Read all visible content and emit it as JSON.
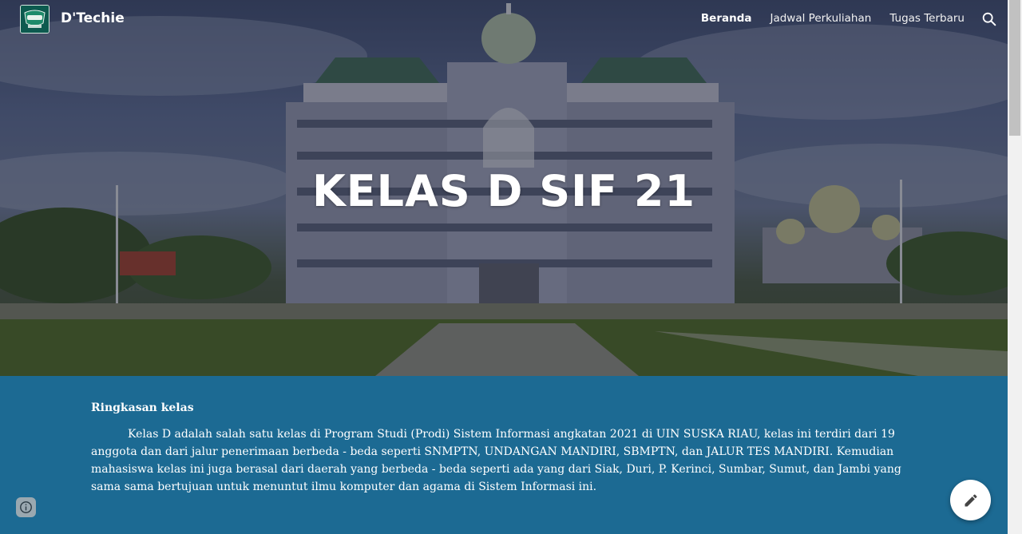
{
  "header": {
    "site_title": "D'Techie",
    "logo_icon": "class-logo-icon",
    "nav_items": [
      {
        "label": "Beranda",
        "active": true
      },
      {
        "label": "Jadwal Perkuliahan",
        "active": false
      },
      {
        "label": "Tugas Terbaru",
        "active": false
      }
    ],
    "search_icon": "search-icon"
  },
  "hero": {
    "title": "KELAS D SIF 21"
  },
  "summary": {
    "heading": "Ringkasan kelas",
    "body": "Kelas D adalah salah satu kelas di Program Studi (Prodi) Sistem Informasi angkatan 2021 di UIN SUSKA RIAU, kelas ini terdiri dari 19 anggota dan dari jalur penerimaan berbeda - beda seperti SNMPTN, UNDANGAN MANDIRI, SBMPTN, dan JALUR TES MANDIRI. Kemudian mahasiswa kelas ini juga berasal dari daerah yang berbeda - beda seperti ada yang dari Siak, Duri, P. Kerinci, Sumbar, Sumut, dan Jambi yang sama sama bertujuan untuk menuntut ilmu komputer dan agama di Sistem Informasi ini."
  },
  "buttons": {
    "info_icon": "info-icon",
    "edit_icon": "pencil-icon"
  },
  "colors": {
    "content_background": "#1c6a93",
    "text": "#ffffff"
  }
}
